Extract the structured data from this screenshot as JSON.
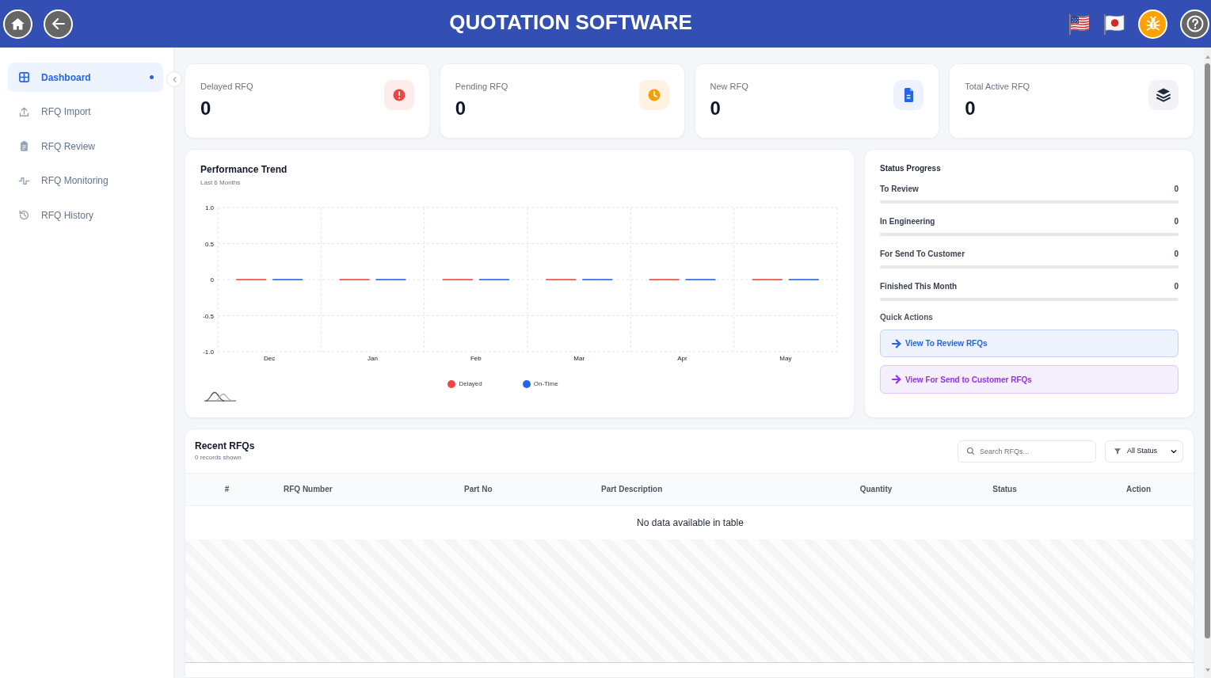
{
  "header": {
    "title": "QUOTATION SOFTWARE"
  },
  "sidebar": {
    "items": [
      {
        "label": "Dashboard",
        "selected": true
      },
      {
        "label": "RFQ Import",
        "selected": false
      },
      {
        "label": "RFQ Review",
        "selected": false
      },
      {
        "label": "RFQ Monitoring",
        "selected": false
      },
      {
        "label": "RFQ History",
        "selected": false
      }
    ]
  },
  "kpis": [
    {
      "label": "Delayed RFQ",
      "value": "0"
    },
    {
      "label": "Pending RFQ",
      "value": "0"
    },
    {
      "label": "New RFQ",
      "value": "0"
    },
    {
      "label": "Total Active RFQ",
      "value": "0"
    }
  ],
  "performance": {
    "title": "Performance Trend",
    "subtitle": "Last 6 Months",
    "chart_data": {
      "type": "bar",
      "categories": [
        "Dec",
        "Jan",
        "Feb",
        "Mar",
        "Apr",
        "May"
      ],
      "series": [
        {
          "name": "Delayed",
          "color": "#ef4444",
          "values": [
            0,
            0,
            0,
            0,
            0,
            0
          ]
        },
        {
          "name": "On-Time",
          "color": "#2563eb",
          "values": [
            0,
            0,
            0,
            0,
            0,
            0
          ]
        }
      ],
      "ylim": [
        -1,
        1
      ],
      "yticks": [
        {
          "value": 1,
          "label": "1.0"
        },
        {
          "value": 0.5,
          "label": "0.5"
        },
        0,
        {
          "value": -0.5,
          "label": "-0.5"
        },
        {
          "value": -1,
          "label": "-1.0"
        }
      ],
      "grid": true
    }
  },
  "status_progress": {
    "title": "Status Progress",
    "items": [
      {
        "label": "To Review",
        "value": "0",
        "level": 0
      },
      {
        "label": "In Engineering",
        "value": "0",
        "level": 0
      },
      {
        "label": "For Send To Customer",
        "value": "0",
        "level": 0
      },
      {
        "label": "Finished This Month",
        "value": "0",
        "level": 0
      }
    ]
  },
  "quick_actions": {
    "title": "Quick Actions",
    "items": [
      {
        "label": "View To Review RFQs",
        "color": "#2563eb"
      },
      {
        "label": "View For Send to Customer RFQs",
        "color": "#9333ea"
      }
    ]
  },
  "recent_rfqs": {
    "title": "Recent RFQs",
    "subtitle": "0 records shown",
    "search": {
      "placeholder": "Search RFQs..."
    },
    "filter": {
      "value": "All Status"
    },
    "table": {
      "columns": [
        "#",
        "RFQ Number",
        "Part No",
        "Part Description",
        "Quantity",
        "Status",
        "Action"
      ],
      "empty_message": "No data available in table"
    }
  }
}
